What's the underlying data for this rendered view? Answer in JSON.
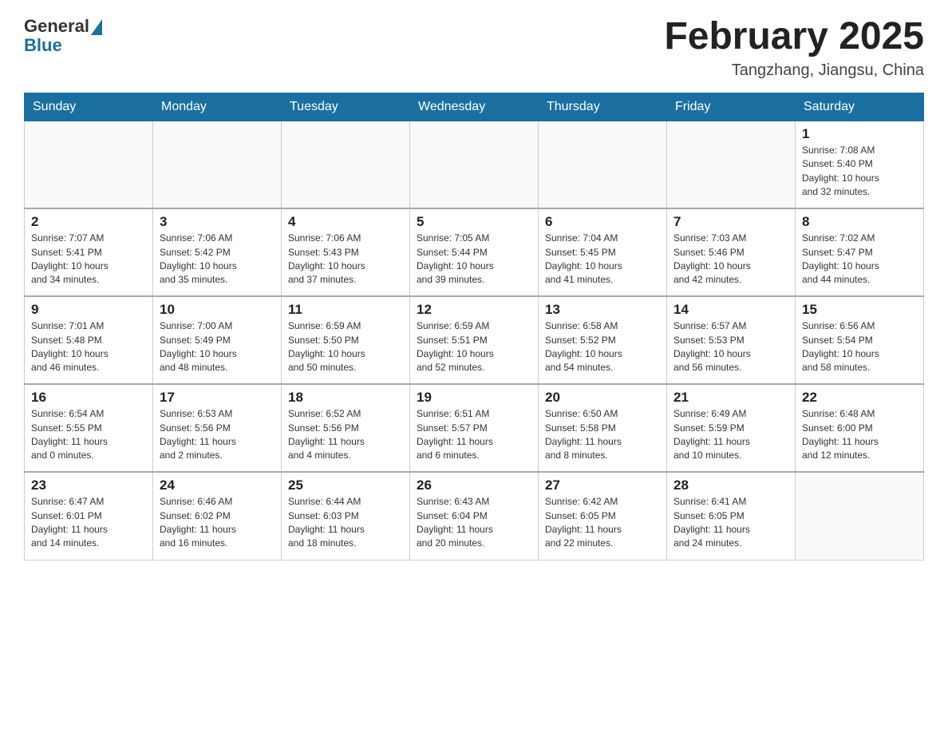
{
  "header": {
    "logo_general": "General",
    "logo_blue": "Blue",
    "title": "February 2025",
    "subtitle": "Tangzhang, Jiangsu, China"
  },
  "weekdays": [
    "Sunday",
    "Monday",
    "Tuesday",
    "Wednesday",
    "Thursday",
    "Friday",
    "Saturday"
  ],
  "weeks": [
    [
      {
        "day": "",
        "info": ""
      },
      {
        "day": "",
        "info": ""
      },
      {
        "day": "",
        "info": ""
      },
      {
        "day": "",
        "info": ""
      },
      {
        "day": "",
        "info": ""
      },
      {
        "day": "",
        "info": ""
      },
      {
        "day": "1",
        "info": "Sunrise: 7:08 AM\nSunset: 5:40 PM\nDaylight: 10 hours\nand 32 minutes."
      }
    ],
    [
      {
        "day": "2",
        "info": "Sunrise: 7:07 AM\nSunset: 5:41 PM\nDaylight: 10 hours\nand 34 minutes."
      },
      {
        "day": "3",
        "info": "Sunrise: 7:06 AM\nSunset: 5:42 PM\nDaylight: 10 hours\nand 35 minutes."
      },
      {
        "day": "4",
        "info": "Sunrise: 7:06 AM\nSunset: 5:43 PM\nDaylight: 10 hours\nand 37 minutes."
      },
      {
        "day": "5",
        "info": "Sunrise: 7:05 AM\nSunset: 5:44 PM\nDaylight: 10 hours\nand 39 minutes."
      },
      {
        "day": "6",
        "info": "Sunrise: 7:04 AM\nSunset: 5:45 PM\nDaylight: 10 hours\nand 41 minutes."
      },
      {
        "day": "7",
        "info": "Sunrise: 7:03 AM\nSunset: 5:46 PM\nDaylight: 10 hours\nand 42 minutes."
      },
      {
        "day": "8",
        "info": "Sunrise: 7:02 AM\nSunset: 5:47 PM\nDaylight: 10 hours\nand 44 minutes."
      }
    ],
    [
      {
        "day": "9",
        "info": "Sunrise: 7:01 AM\nSunset: 5:48 PM\nDaylight: 10 hours\nand 46 minutes."
      },
      {
        "day": "10",
        "info": "Sunrise: 7:00 AM\nSunset: 5:49 PM\nDaylight: 10 hours\nand 48 minutes."
      },
      {
        "day": "11",
        "info": "Sunrise: 6:59 AM\nSunset: 5:50 PM\nDaylight: 10 hours\nand 50 minutes."
      },
      {
        "day": "12",
        "info": "Sunrise: 6:59 AM\nSunset: 5:51 PM\nDaylight: 10 hours\nand 52 minutes."
      },
      {
        "day": "13",
        "info": "Sunrise: 6:58 AM\nSunset: 5:52 PM\nDaylight: 10 hours\nand 54 minutes."
      },
      {
        "day": "14",
        "info": "Sunrise: 6:57 AM\nSunset: 5:53 PM\nDaylight: 10 hours\nand 56 minutes."
      },
      {
        "day": "15",
        "info": "Sunrise: 6:56 AM\nSunset: 5:54 PM\nDaylight: 10 hours\nand 58 minutes."
      }
    ],
    [
      {
        "day": "16",
        "info": "Sunrise: 6:54 AM\nSunset: 5:55 PM\nDaylight: 11 hours\nand 0 minutes."
      },
      {
        "day": "17",
        "info": "Sunrise: 6:53 AM\nSunset: 5:56 PM\nDaylight: 11 hours\nand 2 minutes."
      },
      {
        "day": "18",
        "info": "Sunrise: 6:52 AM\nSunset: 5:56 PM\nDaylight: 11 hours\nand 4 minutes."
      },
      {
        "day": "19",
        "info": "Sunrise: 6:51 AM\nSunset: 5:57 PM\nDaylight: 11 hours\nand 6 minutes."
      },
      {
        "day": "20",
        "info": "Sunrise: 6:50 AM\nSunset: 5:58 PM\nDaylight: 11 hours\nand 8 minutes."
      },
      {
        "day": "21",
        "info": "Sunrise: 6:49 AM\nSunset: 5:59 PM\nDaylight: 11 hours\nand 10 minutes."
      },
      {
        "day": "22",
        "info": "Sunrise: 6:48 AM\nSunset: 6:00 PM\nDaylight: 11 hours\nand 12 minutes."
      }
    ],
    [
      {
        "day": "23",
        "info": "Sunrise: 6:47 AM\nSunset: 6:01 PM\nDaylight: 11 hours\nand 14 minutes."
      },
      {
        "day": "24",
        "info": "Sunrise: 6:46 AM\nSunset: 6:02 PM\nDaylight: 11 hours\nand 16 minutes."
      },
      {
        "day": "25",
        "info": "Sunrise: 6:44 AM\nSunset: 6:03 PM\nDaylight: 11 hours\nand 18 minutes."
      },
      {
        "day": "26",
        "info": "Sunrise: 6:43 AM\nSunset: 6:04 PM\nDaylight: 11 hours\nand 20 minutes."
      },
      {
        "day": "27",
        "info": "Sunrise: 6:42 AM\nSunset: 6:05 PM\nDaylight: 11 hours\nand 22 minutes."
      },
      {
        "day": "28",
        "info": "Sunrise: 6:41 AM\nSunset: 6:05 PM\nDaylight: 11 hours\nand 24 minutes."
      },
      {
        "day": "",
        "info": ""
      }
    ]
  ]
}
